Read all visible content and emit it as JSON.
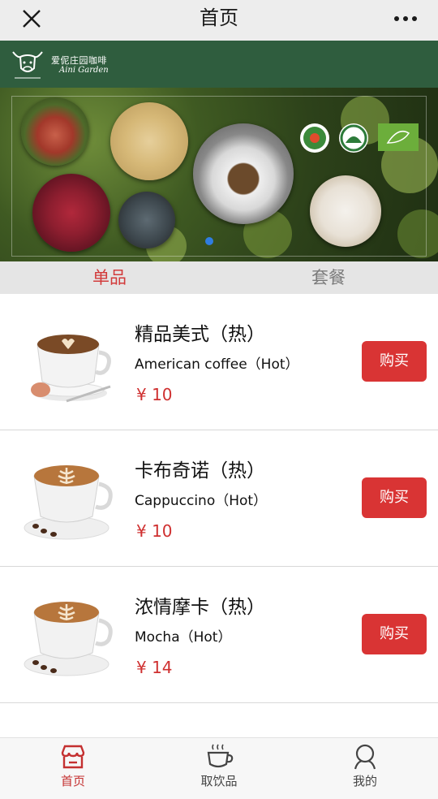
{
  "topbar": {
    "title": "首页",
    "close_icon": "close-icon",
    "more_icon": "more-icon"
  },
  "brand": {
    "name_cn": "爱伲庄园咖啡",
    "name_en": "Aini Garden"
  },
  "banner": {
    "carousel_index": 1,
    "carousel_count": 1
  },
  "tabs": [
    {
      "label": "单品",
      "active": true
    },
    {
      "label": "套餐",
      "active": false
    }
  ],
  "products": [
    {
      "name_cn": "精品美式（热）",
      "name_en": "American coffee（Hot）",
      "price": "¥ 10",
      "buy_label": "购买",
      "image": "americano-cup"
    },
    {
      "name_cn": "卡布奇诺（热）",
      "name_en": "Cappuccino（Hot）",
      "price": "¥ 10",
      "buy_label": "购买",
      "image": "cappuccino-cup"
    },
    {
      "name_cn": "浓情摩卡（热）",
      "name_en": "Mocha（Hot）",
      "price": "¥ 14",
      "buy_label": "购买",
      "image": "mocha-cup"
    }
  ],
  "bottom_nav": [
    {
      "label": "首页",
      "icon": "store-icon",
      "active": true
    },
    {
      "label": "取饮品",
      "icon": "coffee-cup-icon",
      "active": false
    },
    {
      "label": "我的",
      "icon": "user-icon",
      "active": false
    }
  ],
  "colors": {
    "accent_red": "#d93434",
    "brand_green": "#2f5d3e",
    "tab_bg": "#e5e5e5"
  }
}
